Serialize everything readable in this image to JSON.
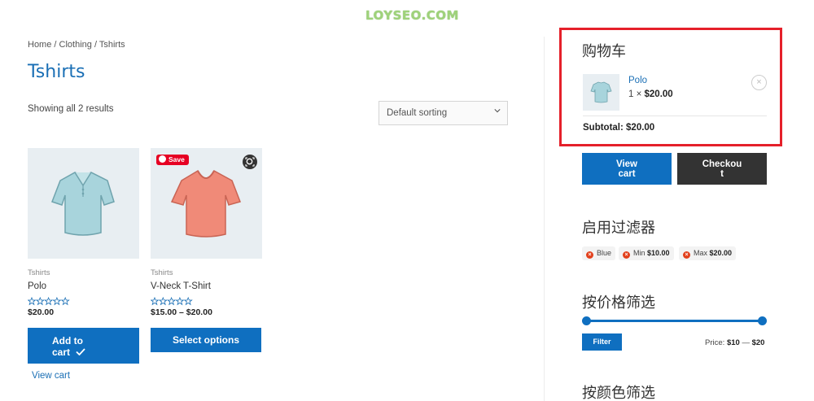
{
  "watermark": "LOYSEO.COM",
  "breadcrumb": {
    "home": "Home",
    "sep": "/",
    "clothing": "Clothing",
    "current": "Tshirts"
  },
  "page_title": "Tshirts",
  "result_count": "Showing all 2 results",
  "sorting": {
    "selected": "Default sorting"
  },
  "products": [
    {
      "category": "Tshirts",
      "name": "Polo",
      "price": "$20.00",
      "button_line1": "Add to",
      "button_line2": "cart",
      "view_cart": "View cart",
      "shirt_color": "#a8d4dc"
    },
    {
      "category": "Tshirts",
      "name": "V-Neck T-Shirt",
      "price": "$15.00 – $20.00",
      "button": "Select options",
      "save_label": "Save",
      "shirt_color": "#f08a78"
    }
  ],
  "cart": {
    "title": "购物车",
    "item_name": "Polo",
    "item_qty": "1 ×",
    "item_price": "$20.00",
    "remove": "×",
    "subtotal_label": "Subtotal:",
    "subtotal_value": "$20.00",
    "view_cart_line1": "View",
    "view_cart_line2": "cart",
    "checkout_line1": "Checkou",
    "checkout_line2": "t"
  },
  "active_filters": {
    "title": "启用过滤器",
    "chips": [
      {
        "label": "Blue",
        "bold": ""
      },
      {
        "label": "Min ",
        "bold": "$10.00"
      },
      {
        "label": "Max ",
        "bold": "$20.00"
      }
    ]
  },
  "price_filter": {
    "title": "按价格筛选",
    "button": "Filter",
    "price_label": "Price:",
    "min": "$10",
    "dash": "—",
    "max": "$20"
  },
  "color_filter": {
    "title": "按颜色筛选"
  },
  "colors": {
    "accent": "#0f6fc0",
    "link": "#1a6fb5",
    "highlight_border": "#e5202a",
    "dark_button": "#333333"
  }
}
